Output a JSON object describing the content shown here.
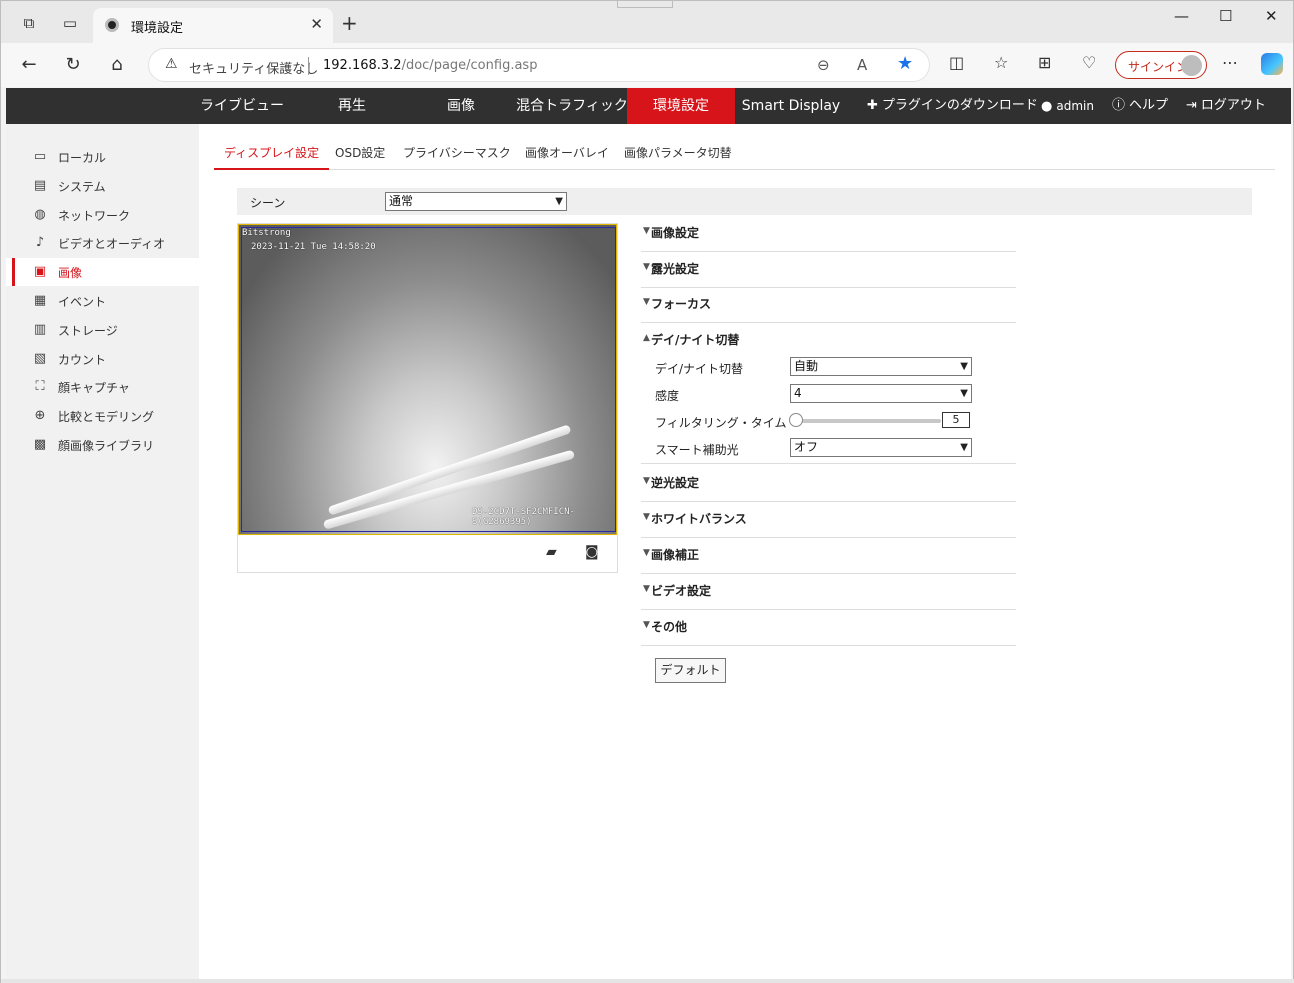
{
  "browser": {
    "tab_title": "環境設定",
    "security_label": "セキュリティ保護なし",
    "url_host": "192.168.3.2",
    "url_path": "/doc/page/config.asp",
    "signin_label": "サインイン"
  },
  "topnav": {
    "items": [
      {
        "label": "ライブビュー"
      },
      {
        "label": "再生"
      },
      {
        "label": "画像"
      },
      {
        "label": "混合トラフィック"
      },
      {
        "label": "環境設定"
      },
      {
        "label": "Smart Display"
      }
    ],
    "plugin_label": "プラグインのダウンロード",
    "user_label": "admin",
    "help_label": "ヘルプ",
    "logout_label": "ログアウト"
  },
  "sidebar": {
    "items": [
      {
        "label": "ローカル",
        "icon": "monitor-icon"
      },
      {
        "label": "システム",
        "icon": "system-icon"
      },
      {
        "label": "ネットワーク",
        "icon": "network-icon"
      },
      {
        "label": "ビデオとオーディオ",
        "icon": "video-audio-icon"
      },
      {
        "label": "画像",
        "icon": "image-icon"
      },
      {
        "label": "イベント",
        "icon": "event-icon"
      },
      {
        "label": "ストレージ",
        "icon": "storage-icon"
      },
      {
        "label": "カウント",
        "icon": "count-icon"
      },
      {
        "label": "顔キャプチャ",
        "icon": "face-capture-icon"
      },
      {
        "label": "比較とモデリング",
        "icon": "compare-icon"
      },
      {
        "label": "顔画像ライブラリ",
        "icon": "face-library-icon"
      }
    ]
  },
  "subtabs": [
    {
      "label": "ディスプレイ設定"
    },
    {
      "label": "OSD設定"
    },
    {
      "label": "プライバシーマスク"
    },
    {
      "label": "画像オーバレイ"
    },
    {
      "label": "画像パラメータ切替"
    }
  ],
  "scene": {
    "label": "シーン",
    "value": "通常"
  },
  "video": {
    "osd_name": "Bitstrong",
    "osd_datetime": "2023-11-21 Tue 14:58:20",
    "osd_model": "DS-2CD7T-SF2CMFICN-S(G2869395)"
  },
  "sections": {
    "image_settings": "画像設定",
    "exposure": "露光設定",
    "focus": "フォーカス",
    "day_night": "デイ/ナイト切替",
    "backlight": "逆光設定",
    "white_balance": "ホワイトバランス",
    "image_enhancement": "画像補正",
    "video_settings": "ビデオ設定",
    "other": "その他"
  },
  "day_night": {
    "switch_label": "デイ/ナイト切替",
    "switch_value": "自動",
    "sensitivity_label": "感度",
    "sensitivity_value": "4",
    "filter_time_label": "フィルタリング・タイム",
    "filter_time_value": "5",
    "smart_ir_label": "スマート補助光",
    "smart_ir_value": "オフ"
  },
  "default_button": "デフォルト",
  "colors": {
    "accent": "#d7141a",
    "nav_bg": "#303030"
  }
}
